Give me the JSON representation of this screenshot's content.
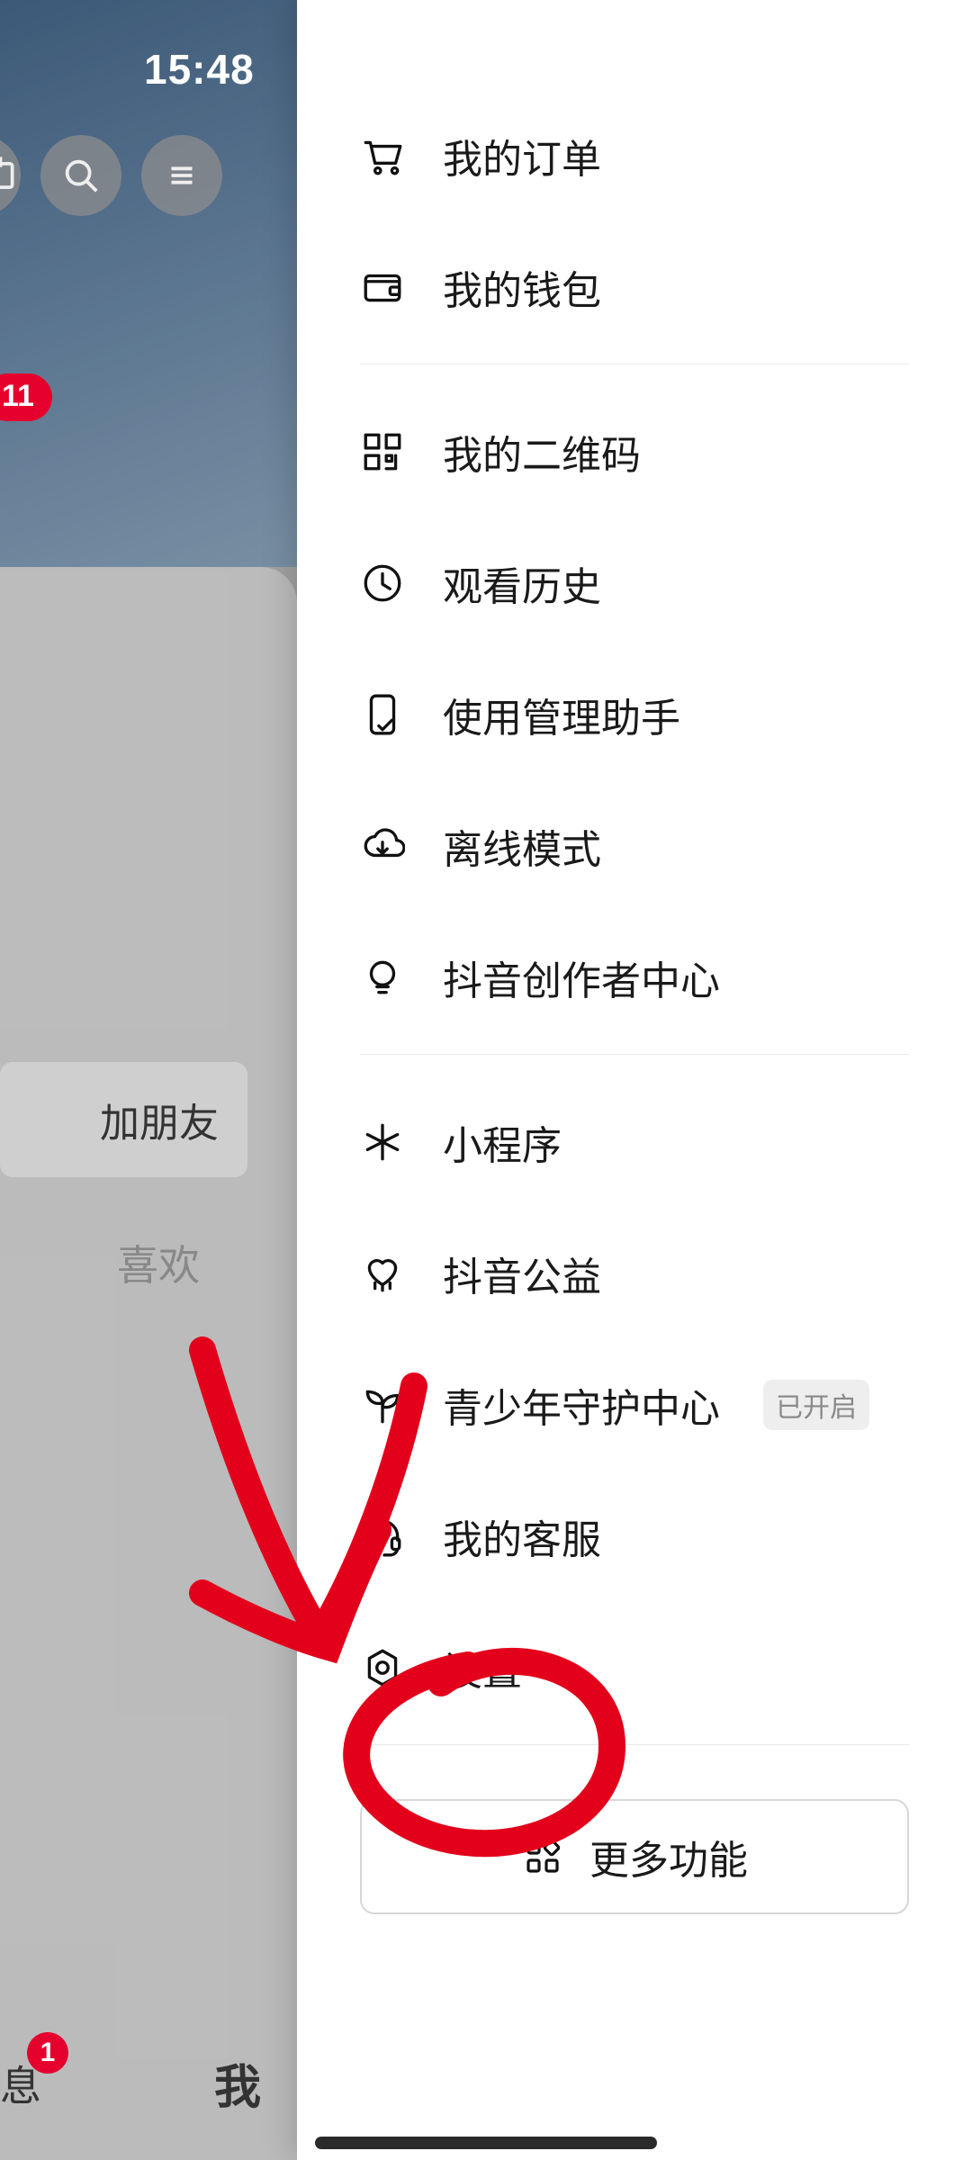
{
  "status": {
    "time": "15:48"
  },
  "profile_back": {
    "badge_count": "11",
    "add_friend_fragment": "加朋友",
    "tab_like": "喜欢",
    "nav_msg_fragment": "息",
    "nav_msg_badge": "1",
    "nav_me": "我"
  },
  "drawer": {
    "items": {
      "orders": {
        "label": "我的订单"
      },
      "wallet": {
        "label": "我的钱包"
      },
      "qrcode": {
        "label": "我的二维码"
      },
      "history": {
        "label": "观看历史"
      },
      "assist": {
        "label": "使用管理助手"
      },
      "offline": {
        "label": "离线模式"
      },
      "creator": {
        "label": "抖音创作者中心"
      },
      "miniapp": {
        "label": "小程序"
      },
      "charity": {
        "label": "抖音公益"
      },
      "teen": {
        "label": "青少年守护中心",
        "tag": "已开启"
      },
      "support": {
        "label": "我的客服"
      },
      "settings": {
        "label": "设置"
      }
    },
    "more_button": "更多功能"
  }
}
